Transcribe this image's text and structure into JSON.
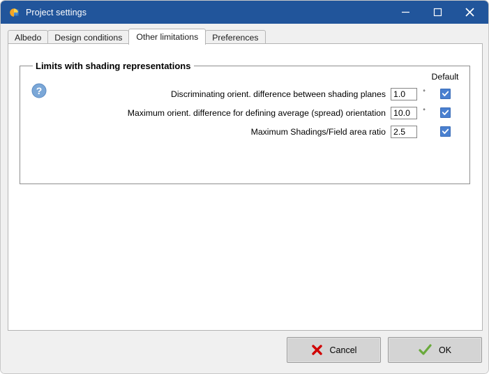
{
  "window": {
    "title": "Project settings",
    "icon": "pvsyst-app-icon",
    "controls": {
      "minimize": "–",
      "maximize": "□",
      "close": "✕"
    },
    "accent_color": "#21559b"
  },
  "tabs": [
    {
      "label": "Albedo",
      "active": false
    },
    {
      "label": "Design conditions",
      "active": false
    },
    {
      "label": "Other limitations",
      "active": true
    },
    {
      "label": "Preferences",
      "active": false
    }
  ],
  "group": {
    "title": "Limits with shading representations",
    "help_icon": "question-mark-icon",
    "default_column_header": "Default",
    "rows": [
      {
        "label": "Discriminating orient. difference between shading planes",
        "value": "1.0",
        "unit": "°",
        "default_checked": true
      },
      {
        "label": "Maximum orient. difference for defining average (spread) orientation",
        "value": "10.0",
        "unit": "°",
        "default_checked": true
      },
      {
        "label": "Maximum Shadings/Field area ratio",
        "value": "2.5",
        "unit": "",
        "default_checked": true
      }
    ]
  },
  "footer": {
    "cancel_label": "Cancel",
    "cancel_icon": "red-x-icon",
    "ok_label": "OK",
    "ok_icon": "green-check-icon",
    "cancel_icon_color": "#d00000",
    "ok_icon_color": "#6aaa3c"
  }
}
